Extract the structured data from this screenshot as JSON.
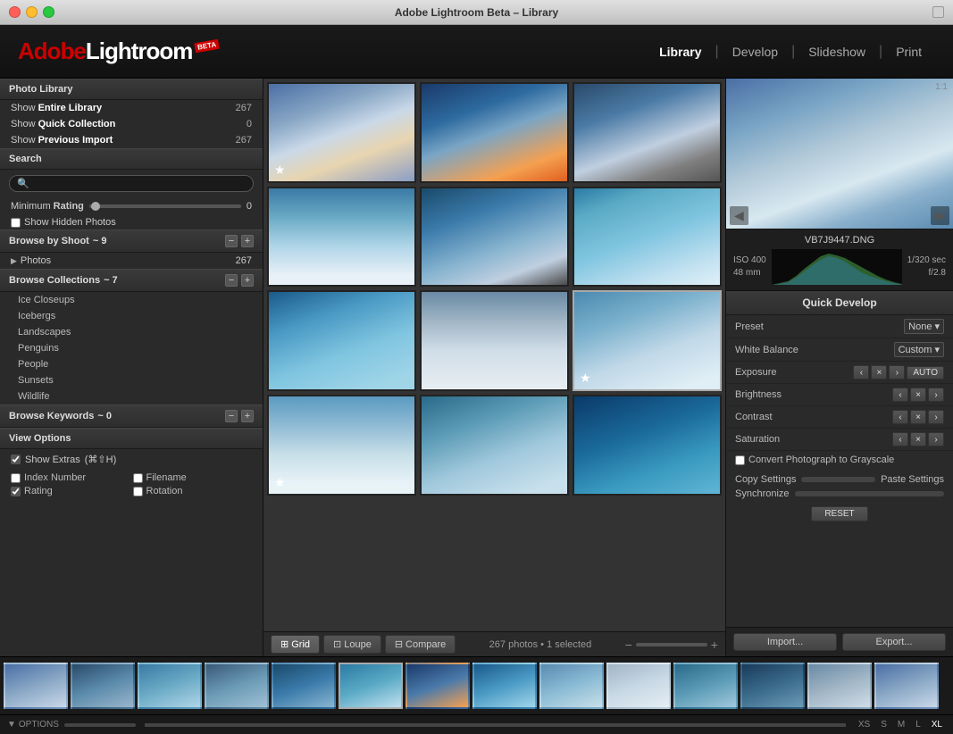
{
  "window": {
    "title": "Adobe Lightroom Beta – Library",
    "traffic_lights": [
      "close",
      "minimize",
      "maximize"
    ]
  },
  "header": {
    "logo_adobe": "Adobe",
    "logo_lightroom": "Lightroom",
    "beta_label": "BETA",
    "nav": {
      "library": "Library",
      "develop": "Develop",
      "slideshow": "Slideshow",
      "print": "Print"
    }
  },
  "left_sidebar": {
    "photo_library_header": "Photo Library",
    "items": [
      {
        "label": "Show ",
        "bold": "Entire Library",
        "count": "267"
      },
      {
        "label": "Show ",
        "bold": "Quick Collection",
        "count": "0"
      },
      {
        "label": "Show ",
        "bold": "Previous Import",
        "count": "267"
      }
    ],
    "search": {
      "header": "Search",
      "placeholder": "Q",
      "min_rating_label": "Minimum Rating",
      "min_rating_value": "0",
      "show_hidden_label": "Show Hidden Photos"
    },
    "browse_by_shoot": {
      "header": "Browse by Shoot",
      "count_label": "~ 9",
      "photos_label": "Photos",
      "photos_count": "267"
    },
    "browse_collections": {
      "header": "Browse Collections",
      "count_label": "~ 7",
      "items": [
        "Ice Closeups",
        "Icebergs",
        "Landscapes",
        "Penguins",
        "People",
        "Sunsets",
        "Wildlife"
      ]
    },
    "browse_keywords": {
      "header": "Browse Keywords",
      "count_label": "~ 0"
    },
    "view_options": {
      "header": "View Options",
      "show_extras_label": "Show Extras",
      "show_extras_shortcut": "(⌘⇧H)",
      "checkboxes": [
        {
          "label": "Index Number",
          "checked": false
        },
        {
          "label": "Filename",
          "checked": false
        },
        {
          "label": "Rating",
          "checked": true
        },
        {
          "label": "Rotation",
          "checked": false
        }
      ]
    }
  },
  "center": {
    "photo_count": "267 photos • 1 selected",
    "view_buttons": [
      {
        "label": "Grid",
        "icon": "grid-icon",
        "active": true
      },
      {
        "label": "Loupe",
        "icon": "loupe-icon",
        "active": false
      },
      {
        "label": "Compare",
        "icon": "compare-icon",
        "active": false
      }
    ],
    "zoom_minus": "−",
    "zoom_plus": "+"
  },
  "right_sidebar": {
    "preview_label": "1:1",
    "filename": "VB7J9447.DNG",
    "exif": {
      "iso": "ISO 400",
      "focal_length": "48 mm",
      "shutter": "1/320 sec",
      "aperture": "f/2.8"
    },
    "quick_develop": {
      "header": "Quick Develop",
      "preset_label": "Preset",
      "preset_value": "None",
      "white_balance_label": "White Balance",
      "white_balance_value": "Custom",
      "controls": [
        {
          "label": "Exposure",
          "has_auto": true
        },
        {
          "label": "Brightness",
          "has_auto": false
        },
        {
          "label": "Contrast",
          "has_auto": false
        },
        {
          "label": "Saturation",
          "has_auto": false
        }
      ],
      "grayscale_label": "Convert Photograph to Grayscale",
      "copy_settings_label": "Copy Settings",
      "paste_settings_label": "Paste Settings",
      "synchronize_label": "Synchronize",
      "reset_label": "RESET"
    },
    "import_btn": "Import...",
    "export_btn": "Export..."
  },
  "statusbar": {
    "options_label": "OPTIONS",
    "size_labels": [
      "XS",
      "S",
      "M",
      "L",
      "XL"
    ]
  }
}
